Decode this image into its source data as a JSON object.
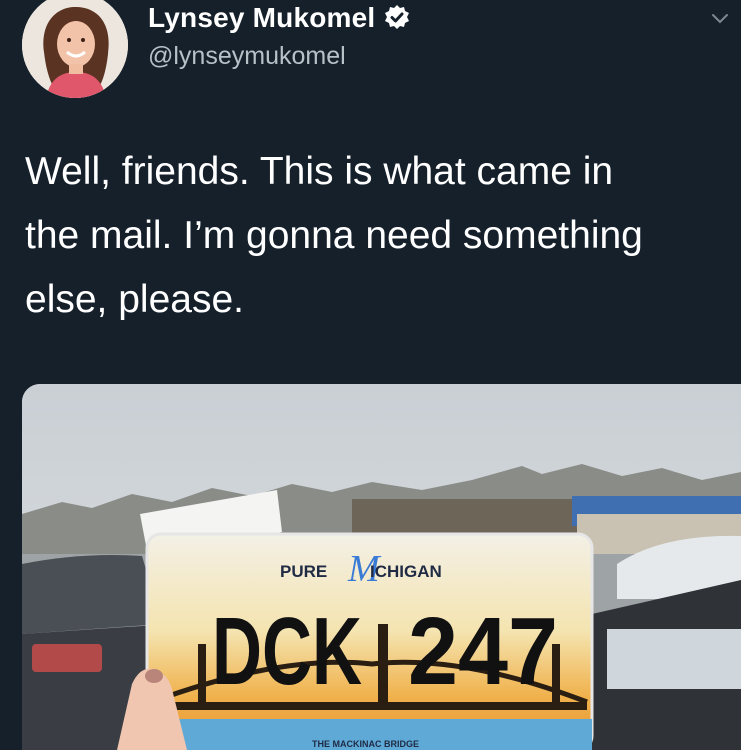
{
  "tweet": {
    "author": {
      "display_name": "Lynsey Mukomel",
      "handle": "@lynseymukomel",
      "verified": true
    },
    "text": "Well, friends. This is what came in the mail. I’m gonna need something else, please.",
    "text_lines": [
      "Well, friends. This is what came in",
      "the mail. I’m gonna need something",
      "else, please."
    ],
    "media": {
      "plate": {
        "brand_left": "PURE",
        "brand_right": "ICHIGAN",
        "number_left": "DCK",
        "number_right": "247",
        "footer": "THE MACKINAC BRIDGE"
      }
    }
  },
  "icons": {
    "verified": "verified-badge-icon",
    "menu": "chevron-down-icon"
  },
  "colors": {
    "background": "#15202b",
    "verified_blue": "#ffffff",
    "handle_gray": "#b8c0c8"
  }
}
